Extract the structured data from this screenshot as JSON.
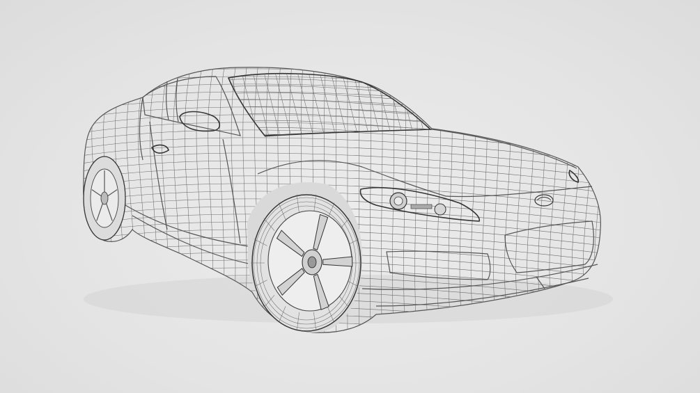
{
  "scene": {
    "subject_icon": "wireframe-sports-car",
    "background_color": "#e6e6e6",
    "wire_color": "#555555",
    "surface_color": "#ececec"
  }
}
